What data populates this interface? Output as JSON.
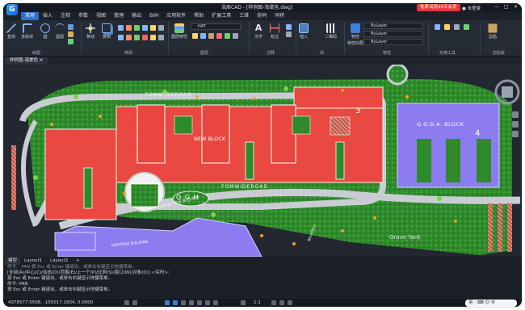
{
  "app": {
    "logo_letter": "G",
    "window_title": "浩辰CAD - [样例图-海棠色.dwg]",
    "trial_badge": "免费试用30天会员",
    "login_label": "未登录",
    "controls": [
      "—",
      "□",
      "✕"
    ]
  },
  "menu": {
    "items": [
      "常用",
      "插入",
      "注释",
      "参数",
      "视图",
      "管理",
      "输出",
      "BIM",
      "应用软件",
      "帮助",
      "扩展工具",
      "三维",
      "协同",
      "同将"
    ],
    "active_index": 0
  },
  "ribbon": {
    "draw_tools": [
      "直线",
      "多段线",
      "圆",
      "圆弧"
    ],
    "modify_tools": [
      "移动",
      "复制"
    ],
    "annotation_tools": [
      "文字",
      "标注"
    ],
    "insert_tools": [
      "插入"
    ],
    "block_tools": [
      "二维码"
    ],
    "property_tools": [
      "特性",
      "特性匹配"
    ],
    "right_tools": [
      "剪贴"
    ],
    "layer_label": "图层特性",
    "hatch_value": "HAT",
    "bylayer_1": "ByLayer",
    "bylayer_2": "ByLayer",
    "bylayer_3": "ByLayer",
    "groups": [
      "绘图",
      "修改",
      "图层",
      "注释",
      "块",
      "特性",
      "实用工具",
      "剪贴板"
    ]
  },
  "document_tab": "样例图-海棠色 ✕",
  "map_labels": {
    "road_top": "FOMWIDEROAD",
    "road_mid": "FOMWIDEROAD",
    "road_low": "FOMWIDEROAD",
    "block_new": "NEW BLOCK",
    "block_3": "3",
    "block_ooda": "Q.O.D.A. BLOCK",
    "block_4": "4",
    "ogh": "O G H",
    "grave_yard": "Grave Yard",
    "heritage": "HERITAGE BUILDING",
    "boundary": "Boundary"
  },
  "layout_tabs": [
    "模型",
    "Layout1",
    "Layout2",
    "+"
  ],
  "command_lines": [
    "命令: _PAN  按 Esc 或 Enter 键退出，或单击右键显示快捷菜单。",
    "[全部(A)/中心(C)/动态(D)/范围(E)/上一个(P)/比例(S)/窗口(W)/对象(O)] <实时>:",
    "按 Esc 或 Enter 键退出，或单击右键显示快捷菜单。",
    "命令: PAN",
    "按 Esc 或 Enter 键退出，或单击右键显示快捷菜单。"
  ],
  "status": {
    "coordinates": "4378577.5508, -155017.1834, 0.0000",
    "scale": "1:1",
    "ime": "英  ·  ⌨  ☺  ⚙"
  },
  "colors": {
    "accent": "#2d6fd0",
    "background": "#222730",
    "block_red": "#e8463f",
    "block_purple": "#8c7cf0",
    "lawn_green": "#2f8a2c",
    "road_gray": "#c9ccd2"
  }
}
